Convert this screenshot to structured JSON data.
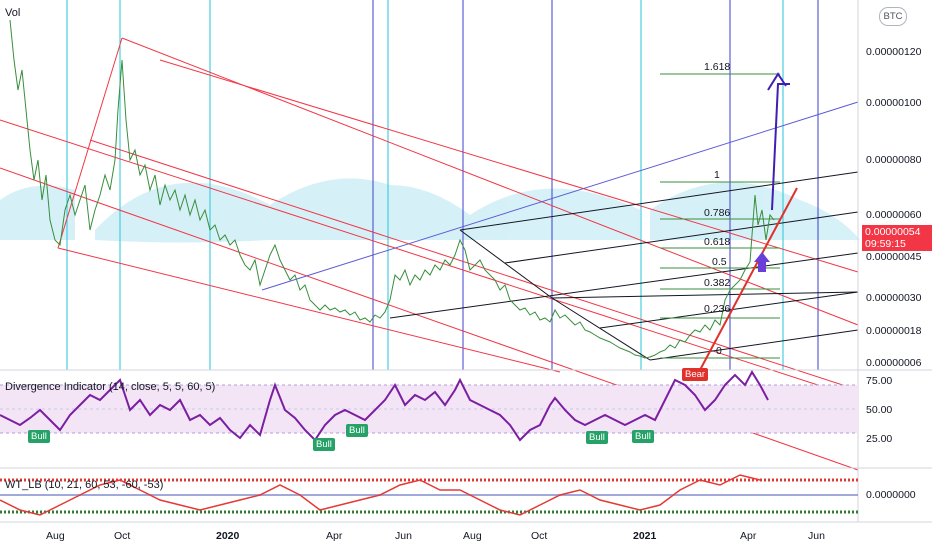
{
  "header": {
    "vol_label": "Vol",
    "currency_badge": "BTC"
  },
  "price_axis": {
    "ticks": [
      "0.00000120",
      "0.00000100",
      "0.00000080",
      "0.00000060",
      "0.00000045",
      "0.00000030",
      "0.00000018",
      "0.00000006"
    ],
    "last_price": "0.00000054",
    "countdown": "09:59:15"
  },
  "fib_levels": [
    "1.618",
    "1",
    "0.786",
    "0.618",
    "0.5",
    "0.382",
    "0.236",
    "0"
  ],
  "time_axis": [
    {
      "label": "Aug",
      "bold": false
    },
    {
      "label": "Oct",
      "bold": false
    },
    {
      "label": "2020",
      "bold": true
    },
    {
      "label": "Apr",
      "bold": false
    },
    {
      "label": "Jun",
      "bold": false
    },
    {
      "label": "Aug",
      "bold": false
    },
    {
      "label": "Oct",
      "bold": false
    },
    {
      "label": "2021",
      "bold": true
    },
    {
      "label": "Apr",
      "bold": false
    },
    {
      "label": "Jun",
      "bold": false
    }
  ],
  "divergence_pane": {
    "title": "Divergence Indicator (14, close, 5, 5, 60, 5)",
    "ticks": [
      "75.00",
      "50.00",
      "25.00"
    ],
    "signals": [
      "Bull",
      "Bull",
      "Bull",
      "Bull",
      "Bull",
      "Bear"
    ]
  },
  "wt_pane": {
    "title": "WT_LB (10, 21, 60, 53, -60, -53)",
    "ticks": [
      "0.0000000"
    ]
  },
  "colors": {
    "teal_vline": "#26c6da",
    "blue_vline": "#3f3fd1",
    "pitchfork": "#f23645",
    "channel": "#131722",
    "rsi": "#7b1fa2",
    "wt_red": "#e53935",
    "wt_green": "#2e7d32",
    "wt_blue": "#7986cb",
    "arc_fill": "#cfeef7",
    "rsi_band": "#f3e5f5"
  }
}
